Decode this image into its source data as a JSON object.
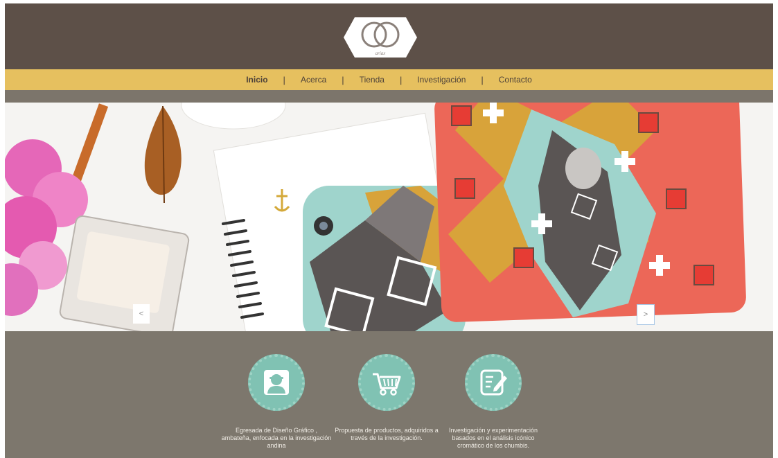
{
  "logo": {
    "text": "ariax",
    "icon": "logo-icon"
  },
  "nav": {
    "items": [
      "Inicio",
      "Acerca",
      "Tienda",
      "Investigación",
      "Contacto"
    ],
    "separator": "|"
  },
  "carousel": {
    "prev_label": "<",
    "next_label": ">"
  },
  "features": [
    {
      "icon": "user-icon",
      "caption": "Egresada de Diseño Gráfico , ambateña, enfocada en la investigación  andina"
    },
    {
      "icon": "shopping-cart-icon",
      "caption": "Propuesta de productos, adquiridos a través de la investigación."
    },
    {
      "icon": "edit-document-icon",
      "caption": "Investigación y experimentación basados en el análisis icónico cromático de los chumbis."
    }
  ],
  "colors": {
    "header": "#5d5048",
    "nav": "#e6c05f",
    "features_bg": "#7d776d",
    "icon_circle": "#80c2b3"
  }
}
